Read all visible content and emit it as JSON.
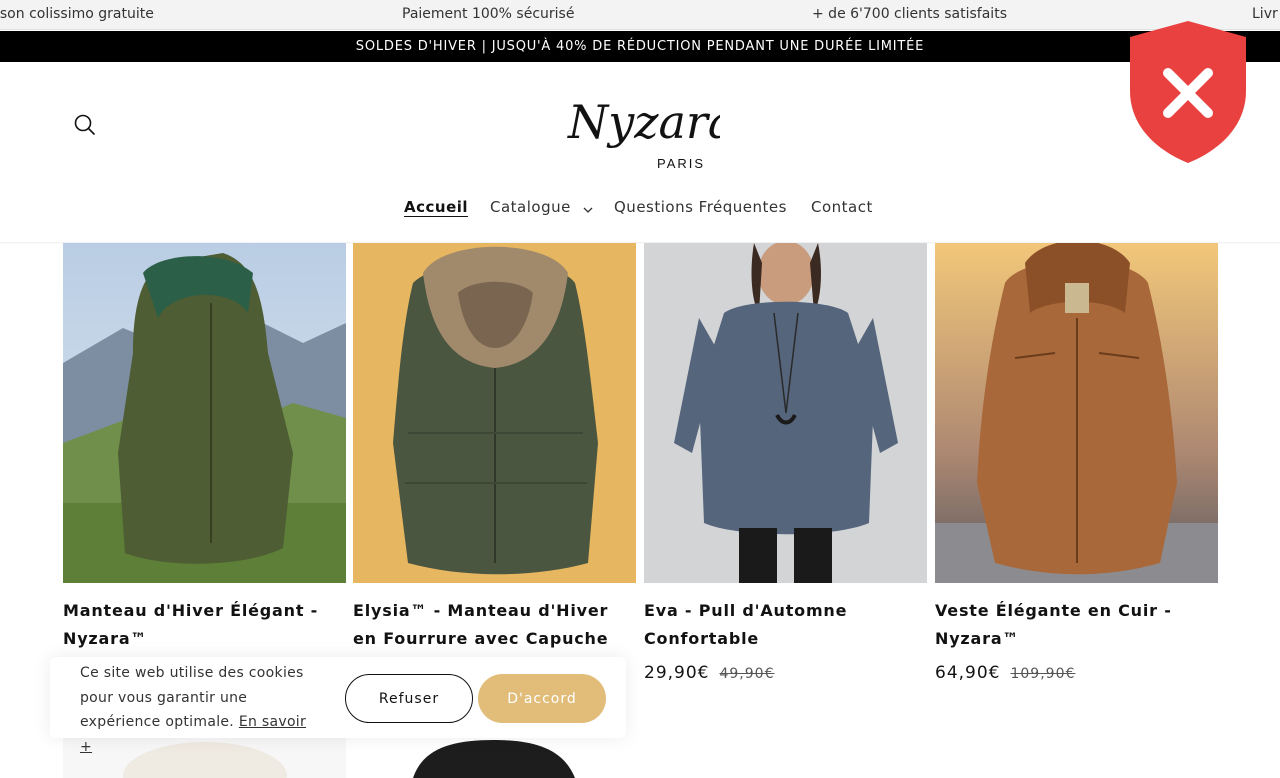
{
  "ticker": {
    "items": [
      "ison colissimo gratuite",
      "Paiement 100% sécurisé",
      "+ de 6'700 clients satisfaits",
      "Livr"
    ]
  },
  "promo_bar": {
    "text": "SOLDES D'HIVER | JUSQU'À 40% DE RÉDUCTION PENDANT UNE DURÉE LIMITÉE"
  },
  "header": {
    "logo": {
      "brand": "Nyzara",
      "sub": "PARIS"
    },
    "nav": [
      {
        "label": "Accueil",
        "active": true
      },
      {
        "label": "Catalogue",
        "has_dropdown": true
      },
      {
        "label": "Questions Fréquentes"
      },
      {
        "label": "Contact"
      }
    ],
    "security_badge": {
      "icon": "shield-x-icon",
      "color": "#e8413f"
    }
  },
  "products": [
    {
      "title": "Manteau d'Hiver Élégant - Nyzara™",
      "price": "",
      "old_price": ""
    },
    {
      "title": "Elysia™ - Manteau d'Hiver en Fourrure avec Capuche",
      "price": "",
      "old_price": ""
    },
    {
      "title": "Eva - Pull d'Automne Confortable",
      "price": "29,90€",
      "old_price": "49,90€"
    },
    {
      "title": "Veste Élégante en Cuir - Nyzara™",
      "price": "64,90€",
      "old_price": "109,90€"
    }
  ],
  "cookie_banner": {
    "text": "Ce site web utilise des cookies pour vous garantir une expérience optimale.",
    "link": "En savoir +",
    "refuse": "Refuser",
    "accept": "D'accord"
  },
  "colors": {
    "accent": "#e1bd79",
    "promo_bg": "#000000",
    "badge": "#e8413f"
  }
}
